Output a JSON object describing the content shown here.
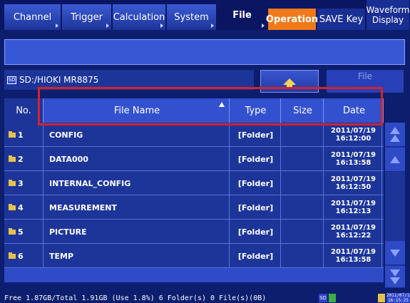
{
  "tabs": [
    {
      "label": "Channel"
    },
    {
      "label": "Trigger"
    },
    {
      "label": "Calculation"
    },
    {
      "label": "System"
    },
    {
      "label": "File"
    },
    {
      "label": "Operation"
    },
    {
      "label": "SAVE Key"
    },
    {
      "label_line1": "Waveform",
      "label_line2": "Display"
    }
  ],
  "path": {
    "drive": "SD",
    "text": "SD:/HIOKI MR8875"
  },
  "file_button": "File",
  "columns": {
    "no": "No.",
    "name": "File Name",
    "type": "Type",
    "size": "Size",
    "date": "Date"
  },
  "rows": [
    {
      "no": "1",
      "name": "CONFIG",
      "type": "[Folder]",
      "size": "",
      "date": "2011/07/19",
      "time": "16:12:00"
    },
    {
      "no": "2",
      "name": "DATA000",
      "type": "[Folder]",
      "size": "",
      "date": "2011/07/19",
      "time": "16:13:58"
    },
    {
      "no": "3",
      "name": "INTERNAL_CONFIG",
      "type": "[Folder]",
      "size": "",
      "date": "2011/07/19",
      "time": "16:12:50"
    },
    {
      "no": "4",
      "name": "MEASUREMENT",
      "type": "[Folder]",
      "size": "",
      "date": "2011/07/19",
      "time": "16:12:13"
    },
    {
      "no": "5",
      "name": "PICTURE",
      "type": "[Folder]",
      "size": "",
      "date": "2011/07/19",
      "time": "16:12:22"
    },
    {
      "no": "6",
      "name": "TEMP",
      "type": "[Folder]",
      "size": "",
      "date": "2011/07/19",
      "time": "16:13:58"
    }
  ],
  "status": {
    "text": "Free 1.87GB/Total 1.91GB (Use 1.8%)  6 Folder(s) 0 File(s)(0B)",
    "sd_badge": "SD",
    "clock_date": "2011/07/19",
    "clock_time": "16:15:25"
  },
  "colors": {
    "accent": "#f07a1a",
    "highlight": "#d2242c",
    "panel": "#1d3599"
  }
}
